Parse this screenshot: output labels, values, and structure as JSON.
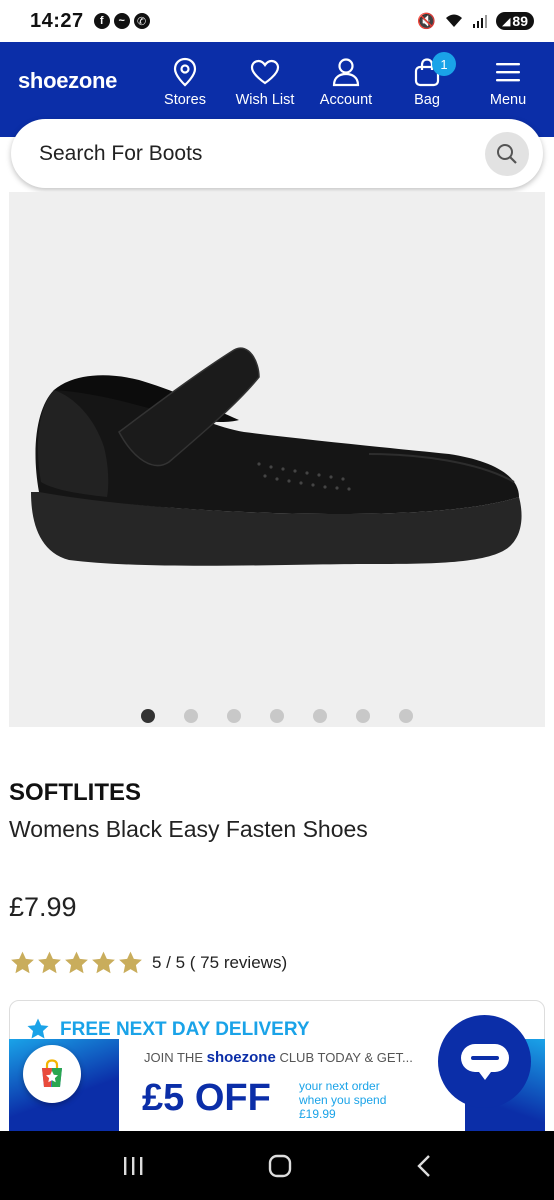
{
  "status_bar": {
    "time": "14:27",
    "battery": "89"
  },
  "header": {
    "logo": "shoezone",
    "nav": [
      {
        "label": "Stores",
        "icon": "location-pin-icon"
      },
      {
        "label": "Wish List",
        "icon": "heart-icon"
      },
      {
        "label": "Account",
        "icon": "person-icon"
      },
      {
        "label": "Bag",
        "icon": "bag-icon"
      },
      {
        "label": "Menu",
        "icon": "hamburger-icon"
      }
    ],
    "bag_count": "1"
  },
  "search": {
    "placeholder": "Search For Boots"
  },
  "product": {
    "brand": "SOFTLITES",
    "name": "Womens Black Easy Fasten Shoes",
    "price": "£7.99",
    "rating": 5,
    "rating_text": "5 / 5 ( 75 reviews)",
    "image_count": 7,
    "active_image_index": 0
  },
  "delivery": {
    "text": "FREE NEXT DAY DELIVERY"
  },
  "promo": {
    "top_prefix": "JOIN THE",
    "top_brand": "shoezone",
    "top_suffix": "CLUB TODAY & GET...",
    "offer": "£5 OFF",
    "line1": "your next order",
    "line2": "when you spend",
    "line3": "£19.99"
  },
  "colors": {
    "brand_blue": "#0b2ea8",
    "accent_blue": "#1aa3e8",
    "star_gold": "#c9ad5c"
  }
}
